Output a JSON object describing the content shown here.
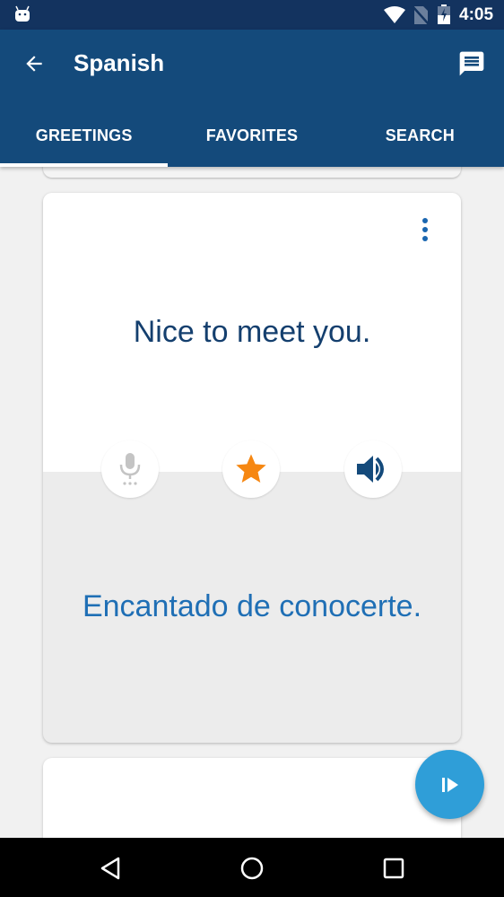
{
  "status_bar": {
    "time": "4:05",
    "icons": [
      "android-notification-icon",
      "wifi-icon",
      "no-sim-icon",
      "battery-charging-icon"
    ]
  },
  "app_bar": {
    "title": "Spanish",
    "back_icon": "arrow-left-icon",
    "action_icon": "chat-message-icon"
  },
  "tabs": [
    {
      "label": "GREETINGS",
      "active": true
    },
    {
      "label": "FAVORITES",
      "active": false
    },
    {
      "label": "SEARCH",
      "active": false
    }
  ],
  "card": {
    "phrase": "Nice to meet you.",
    "translation": "Encantado de conocerte.",
    "more_icon": "more-vertical-icon",
    "actions": [
      {
        "name": "record",
        "icon": "microphone-icon",
        "enabled": false
      },
      {
        "name": "favorite",
        "icon": "star-icon",
        "active": true
      },
      {
        "name": "play-audio",
        "icon": "speaker-icon"
      }
    ]
  },
  "fab": {
    "icon": "play-next-icon"
  },
  "nav_bar": {
    "buttons": [
      "back-triangle-icon",
      "home-circle-icon",
      "recents-square-icon"
    ]
  },
  "colors": {
    "status_bar": "#13335f",
    "app_bar": "#144a7b",
    "phrase_text": "#143f6e",
    "translation_text": "#1f6fb5",
    "star": "#f68712",
    "speaker": "#144a7b",
    "fab": "#2f9ed8",
    "background": "#f1f1f1"
  }
}
